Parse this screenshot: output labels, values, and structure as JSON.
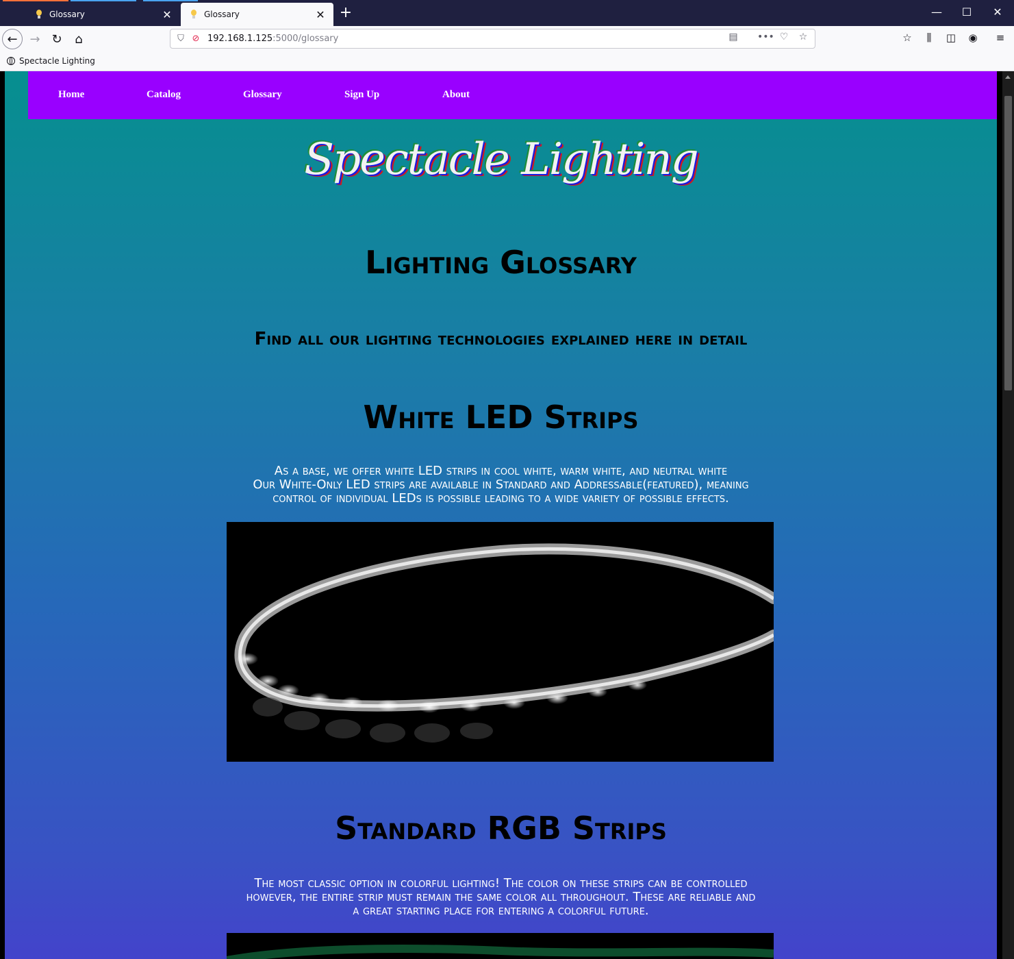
{
  "browser": {
    "tabs": [
      {
        "title": "Glossary",
        "close": "✕"
      },
      {
        "title": "Glossary",
        "close": "✕"
      }
    ],
    "new_tab": "+",
    "window_controls": {
      "minimize": "—",
      "maximize": "☐",
      "close": "✕"
    },
    "url_host": "192.168.1.125",
    "url_path": ":5000/glossary",
    "bookmark": "Spectacle Lighting",
    "icons": [
      "back-icon",
      "forward-icon",
      "reload-icon",
      "home-icon",
      "shield-icon",
      "insecure-lock-icon",
      "reader-icon",
      "more-icon",
      "pocket-icon",
      "star-icon",
      "bookmarks-icon",
      "library-icon",
      "sidebar-icon",
      "account-icon",
      "menu-icon"
    ]
  },
  "site": {
    "nav": [
      "Home",
      "Catalog",
      "Glossary",
      "Sign Up",
      "About"
    ],
    "logo": "Spectacle Lighting",
    "title": "Lighting Glossary",
    "subtitle": "Find all our lighting technologies explained here in detail",
    "sections": [
      {
        "heading": "White LED Strips",
        "lines": [
          "As a base, we offer white LED strips in cool white, warm white, and neutral white",
          "Our White-Only LED strips are available in Standard and Addressable(featured), meaning",
          "control of individual LEDs is possible leading to a wide variety of possible effects."
        ]
      },
      {
        "heading": "Standard RGB Strips",
        "lines": [
          "The most classic option in colorful lighting! The color on these strips can be controlled",
          "however, the entire strip must remain the same color all throughout. These are reliable and",
          "a great starting place for entering a colorful future."
        ]
      }
    ]
  },
  "colors": {
    "nav_bg": "#9900ff",
    "gradient_top": "#068f8f",
    "gradient_bottom": "#4343cb",
    "heading": "#000000",
    "body_text": "#ffffff"
  }
}
